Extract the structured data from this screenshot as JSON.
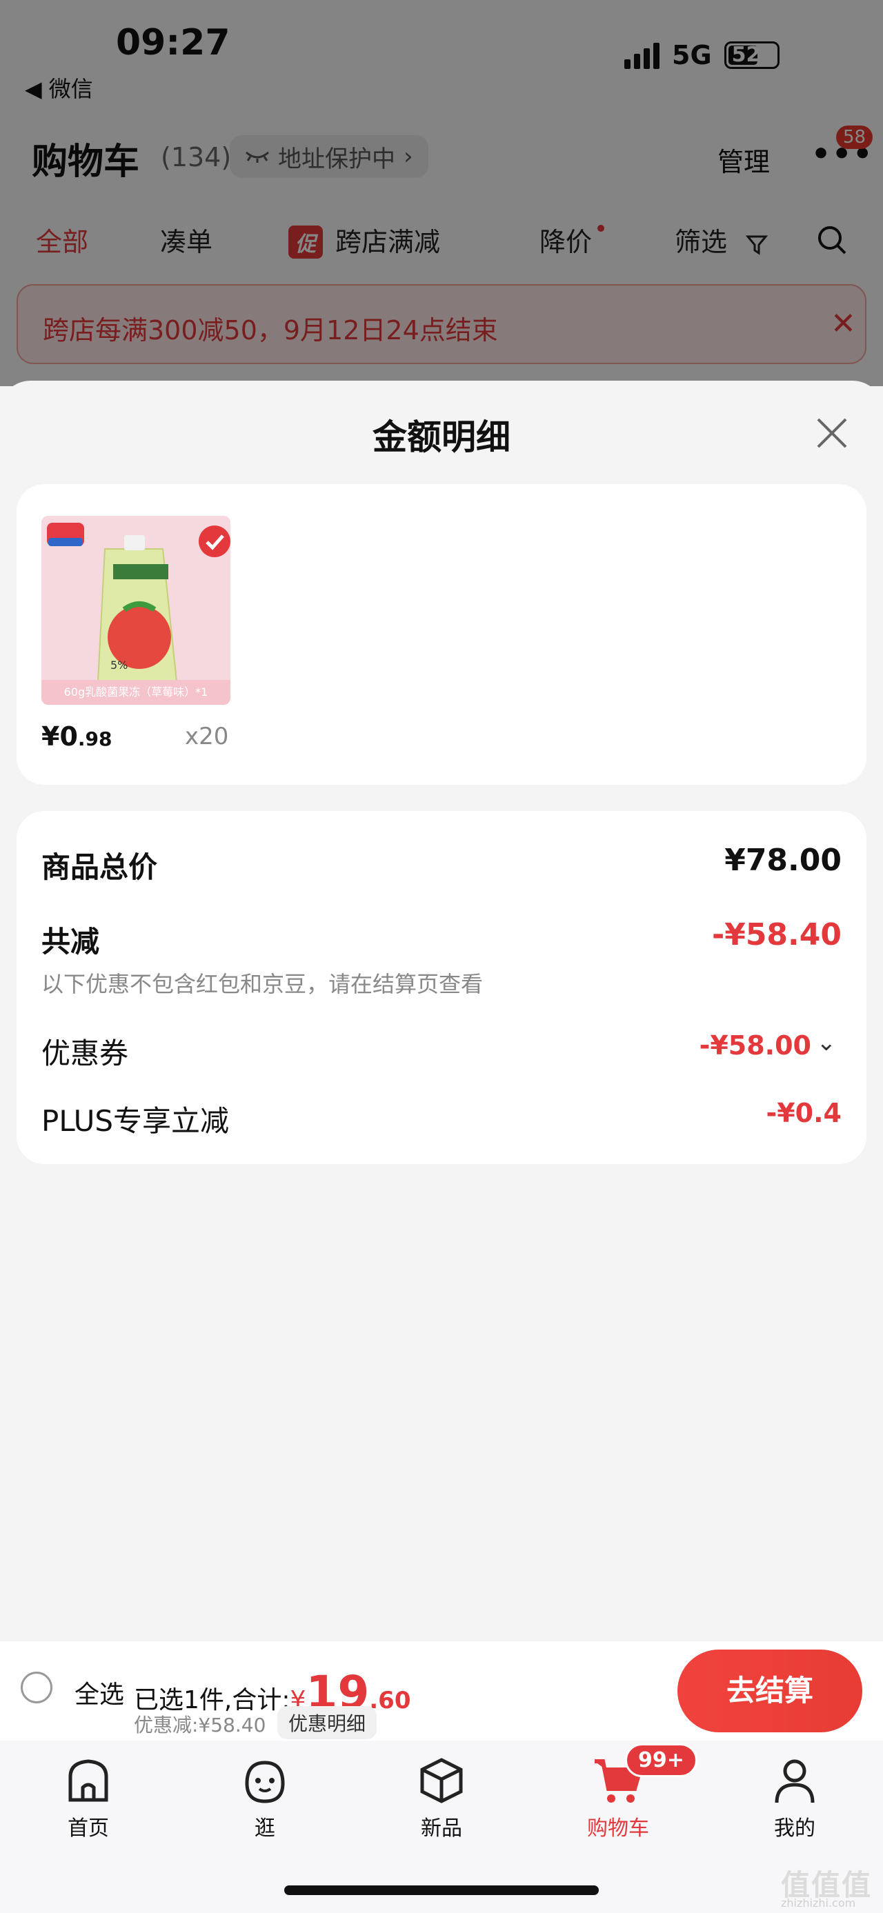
{
  "status": {
    "time": "09:27",
    "back_app": "◀ 微信",
    "network": "5G",
    "battery": "52"
  },
  "header": {
    "title": "购物车",
    "count": "(134)",
    "address_chip": "地址保护中",
    "manage": "管理",
    "more_badge": "58"
  },
  "tabs": [
    {
      "label": "全部",
      "active": true
    },
    {
      "label": "凑单"
    },
    {
      "label": "跨店满减",
      "tag": "促"
    },
    {
      "label": "降价"
    },
    {
      "label": "筛选"
    }
  ],
  "banner": {
    "text": "跨店每满300减50，9月12日24点结束"
  },
  "sheet": {
    "title": "金额明细",
    "item": {
      "price_int": "¥0",
      "price_dec": ".98",
      "qty": "x20",
      "caption": "60g乳酸菌果冻（草莓味）*1"
    },
    "rows": {
      "total_label": "商品总价",
      "total_value": "¥78.00",
      "reduce_label": "共减",
      "reduce_value": "-¥58.40",
      "note": "以下优惠不包含红包和京豆，请在结算页查看",
      "coupon_label": "优惠券",
      "coupon_value": "-¥58.00",
      "plus_label": "PLUS专享立减",
      "plus_value": "-¥0.4"
    }
  },
  "checkout": {
    "select_all": "全选",
    "summary_prefix": "已选1件,合计:",
    "yen": "¥",
    "total_int": "19",
    "total_dec": ".60",
    "discount": "优惠减:¥58.40",
    "detail_link": "优惠明细",
    "button": "去结算"
  },
  "tabbar": [
    {
      "label": "首页",
      "icon": "home-icon"
    },
    {
      "label": "逛",
      "icon": "face-icon"
    },
    {
      "label": "新品",
      "icon": "box-icon"
    },
    {
      "label": "购物车",
      "icon": "cart-icon",
      "active": true,
      "badge": "99+"
    },
    {
      "label": "我的",
      "icon": "user-icon"
    }
  ],
  "watermark": {
    "text": "值值值",
    "sub": "zhizhizhi.com"
  },
  "colors": {
    "accent": "#e4393c"
  }
}
